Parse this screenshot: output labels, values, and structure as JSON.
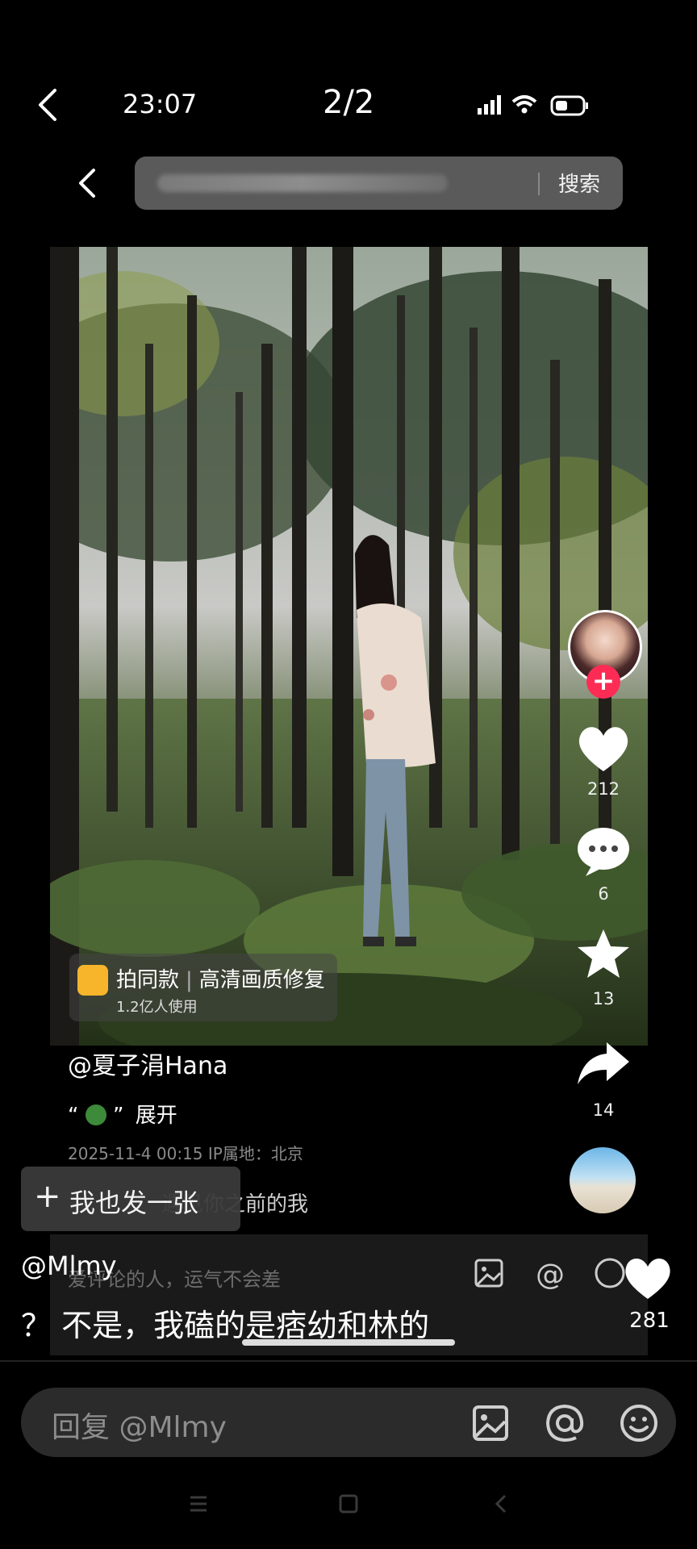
{
  "status": {
    "time": "23:07",
    "counter": "2/2"
  },
  "search": {
    "button": "搜索"
  },
  "actions": {
    "likes": "212",
    "comments": "6",
    "favorites": "13",
    "shares": "14"
  },
  "template_badge": {
    "label": "拍同款",
    "label2": "高清画质修复",
    "sublabel": "1.2亿人使用"
  },
  "post": {
    "handle": "@夏子涓Hana",
    "desc_quote_open": "“",
    "desc_quote_close": "”",
    "expand": "展开",
    "meta": "2025-11-4 00:15  IP属地：北京",
    "underlay_text": "遇见你之前的我",
    "underlay_hint": "爱评论的人，运气不会差"
  },
  "post_button": {
    "plus": "+",
    "label": "我也发一张"
  },
  "comment": {
    "user": "@Mlmy",
    "text": "？ 不是，我磕的是痞幼和林的",
    "likes": "281"
  },
  "reply": {
    "placeholder": "回复 @Mlmy"
  }
}
